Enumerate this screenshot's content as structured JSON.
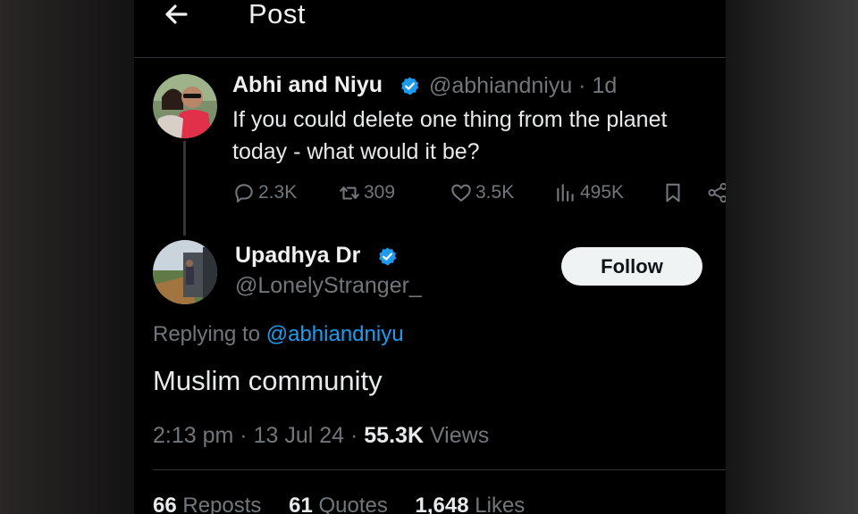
{
  "header": {
    "title": "Post"
  },
  "original_post": {
    "author_name": "Abhi and Niyu",
    "handle": "@abhiandniyu",
    "separator": "·",
    "age": "1d",
    "text": "If you could delete one thing from the planet today - what would it be?",
    "actions": {
      "replies": "2.3K",
      "reposts": "309",
      "likes": "3.5K",
      "views": "495K"
    }
  },
  "reply": {
    "author_name": "Upadhya Dr",
    "handle": "@LonelyStranger_",
    "follow_label": "Follow",
    "replying_prefix": "Replying to",
    "replying_to": "@abhiandniyu",
    "text": "Muslim community",
    "time": "2:13 pm",
    "date": "13 Jul 24",
    "views_count": "55.3K",
    "views_label": "Views",
    "separator": "·"
  },
  "stats": {
    "reposts_count": "66",
    "reposts_label": "Reposts",
    "quotes_count": "61",
    "quotes_label": "Quotes",
    "likes_count": "1,648",
    "likes_label": "Likes"
  },
  "colors": {
    "accent": "#1d9bf0",
    "muted": "#71767b",
    "text": "#e7e9ea",
    "background": "#000000"
  }
}
